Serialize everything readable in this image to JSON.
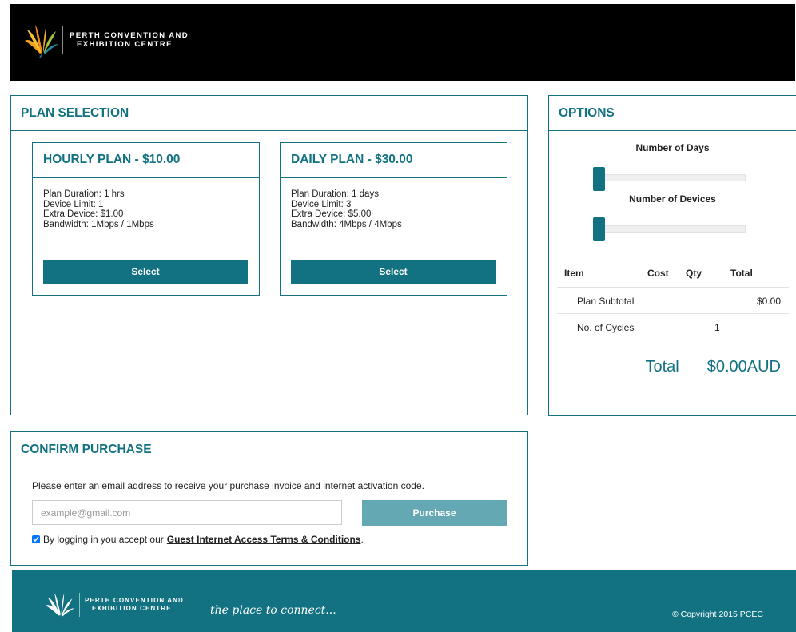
{
  "header": {
    "brand_line1": "PERTH CONVENTION AND",
    "brand_line2": "EXHIBITION CENTRE"
  },
  "plan_selection": {
    "title": "PLAN SELECTION",
    "plans": [
      {
        "title": "HOURLY PLAN - $10.00",
        "duration": "Plan Duration: 1 hrs",
        "device_limit": "Device Limit: 1",
        "extra_device": "Extra Device: $1.00",
        "bandwidth": "Bandwidth: 1Mbps / 1Mbps",
        "select_label": "Select"
      },
      {
        "title": "DAILY PLAN - $30.00",
        "duration": "Plan Duration: 1 days",
        "device_limit": "Device Limit: 3",
        "extra_device": "Extra Device: $5.00",
        "bandwidth": "Bandwidth: 4Mbps / 4Mbps",
        "select_label": "Select"
      }
    ]
  },
  "options": {
    "title": "OPTIONS",
    "days_label": "Number of Days",
    "devices_label": "Number of Devices",
    "table": {
      "headers": {
        "item": "Item",
        "cost": "Cost",
        "qty": "Qty",
        "total": "Total"
      },
      "rows": [
        {
          "item": "Plan Subtotal",
          "cost": "",
          "qty": "",
          "total": "$0.00"
        },
        {
          "item": "No. of Cycles",
          "cost": "",
          "qty": "1",
          "total": ""
        }
      ]
    },
    "total_label": "Total",
    "total_value": "$0.00AUD"
  },
  "confirm": {
    "title": "CONFIRM PURCHASE",
    "instructions": "Please enter an email address to receive your purchase invoice and internet activation code.",
    "email_value": "",
    "email_placeholder": "example@gmail.com",
    "purchase_label": "Purchase",
    "terms_prefix": "By logging in you accept our",
    "terms_link": "Guest Internet Access Terms & Conditions",
    "terms_suffix": "."
  },
  "footer": {
    "brand_line1": "PERTH CONVENTION AND",
    "brand_line2": "EXHIBITION CENTRE",
    "tagline": "the place to connect...",
    "copyright": "© Copyright 2015 PCEC"
  },
  "colors": {
    "accent": "#137281",
    "purchase_button": "#64a8b3",
    "header_bg": "#000000"
  },
  "icons": {
    "brand_logo": "pcec-flower-logo-icon",
    "checkbox": "checkbox-checked-icon"
  }
}
